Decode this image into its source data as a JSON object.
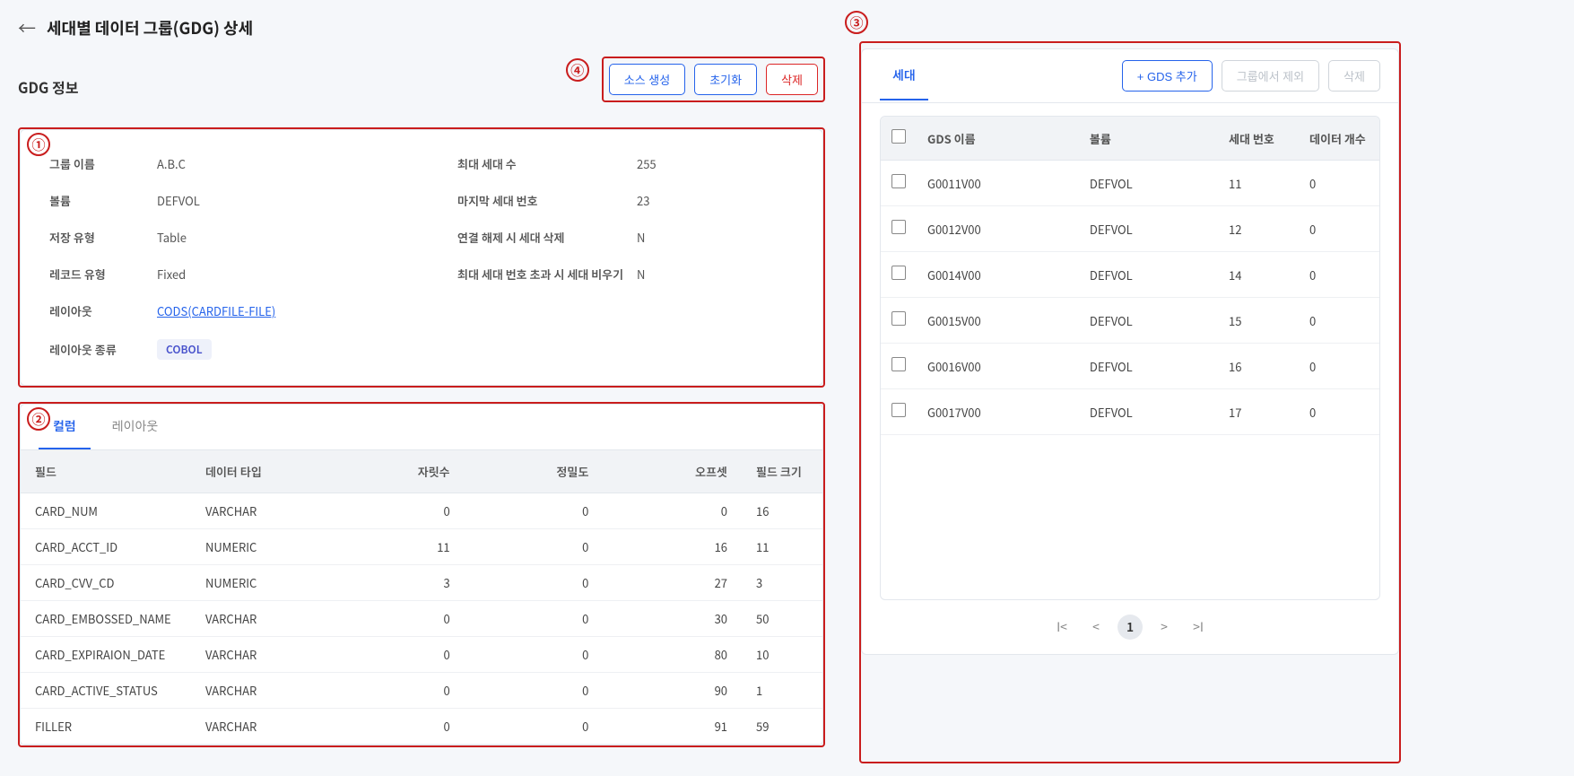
{
  "page": {
    "title": "세대별 데이터 그룹(GDG) 상세",
    "section_title": "GDG 정보"
  },
  "toolbar": {
    "generate_source": "소스 생성",
    "reset": "초기화",
    "delete": "삭제"
  },
  "info": {
    "left": [
      {
        "label": "그룹 이름",
        "value": "A.B.C"
      },
      {
        "label": "볼륨",
        "value": "DEFVOL"
      },
      {
        "label": "저장 유형",
        "value": "Table"
      },
      {
        "label": "레코드 유형",
        "value": "Fixed"
      },
      {
        "label": "레이아웃",
        "value": "CODS(CARDFILE-FILE)",
        "link": true
      },
      {
        "label": "레이아웃 종류",
        "value": "COBOL",
        "badge": true
      }
    ],
    "right": [
      {
        "label": "최대 세대 수",
        "value": "255"
      },
      {
        "label": "마지막 세대 번호",
        "value": "23"
      },
      {
        "label": "연결 해제 시 세대 삭제",
        "value": "N"
      },
      {
        "label": "최대 세대 번호 초과 시 세대 비우기",
        "value": "N"
      }
    ]
  },
  "col_tabs": {
    "columns": "컬럼",
    "layout": "레이아웃"
  },
  "col_headers": {
    "field": "필드",
    "datatype": "데이터 타입",
    "digits": "자릿수",
    "precision": "정밀도",
    "offset": "오프셋",
    "size": "필드 크기"
  },
  "columns": [
    {
      "field": "CARD_NUM",
      "datatype": "VARCHAR",
      "digits": "0",
      "precision": "0",
      "offset": "0",
      "size": "16"
    },
    {
      "field": "CARD_ACCT_ID",
      "datatype": "NUMERIC",
      "digits": "11",
      "precision": "0",
      "offset": "16",
      "size": "11"
    },
    {
      "field": "CARD_CVV_CD",
      "datatype": "NUMERIC",
      "digits": "3",
      "precision": "0",
      "offset": "27",
      "size": "3"
    },
    {
      "field": "CARD_EMBOSSED_NAME",
      "datatype": "VARCHAR",
      "digits": "0",
      "precision": "0",
      "offset": "30",
      "size": "50"
    },
    {
      "field": "CARD_EXPIRAION_DATE",
      "datatype": "VARCHAR",
      "digits": "0",
      "precision": "0",
      "offset": "80",
      "size": "10"
    },
    {
      "field": "CARD_ACTIVE_STATUS",
      "datatype": "VARCHAR",
      "digits": "0",
      "precision": "0",
      "offset": "90",
      "size": "1"
    },
    {
      "field": "FILLER",
      "datatype": "VARCHAR",
      "digits": "0",
      "precision": "0",
      "offset": "91",
      "size": "59"
    }
  ],
  "gen": {
    "tab": "세대",
    "add": "+ GDS 추가",
    "exclude": "그룹에서 제외",
    "delete": "삭제",
    "headers": {
      "name": "GDS 이름",
      "volume": "볼륨",
      "gen_no": "세대 번호",
      "data_count": "데이터 개수"
    },
    "rows": [
      {
        "name": "G0011V00",
        "volume": "DEFVOL",
        "gen_no": "11",
        "count": "0"
      },
      {
        "name": "G0012V00",
        "volume": "DEFVOL",
        "gen_no": "12",
        "count": "0"
      },
      {
        "name": "G0014V00",
        "volume": "DEFVOL",
        "gen_no": "14",
        "count": "0"
      },
      {
        "name": "G0015V00",
        "volume": "DEFVOL",
        "gen_no": "15",
        "count": "0"
      },
      {
        "name": "G0016V00",
        "volume": "DEFVOL",
        "gen_no": "16",
        "count": "0"
      },
      {
        "name": "G0017V00",
        "volume": "DEFVOL",
        "gen_no": "17",
        "count": "0"
      }
    ],
    "pager": {
      "current": "1"
    }
  },
  "callouts": {
    "c1": "①",
    "c2": "②",
    "c3": "③",
    "c4": "④"
  }
}
